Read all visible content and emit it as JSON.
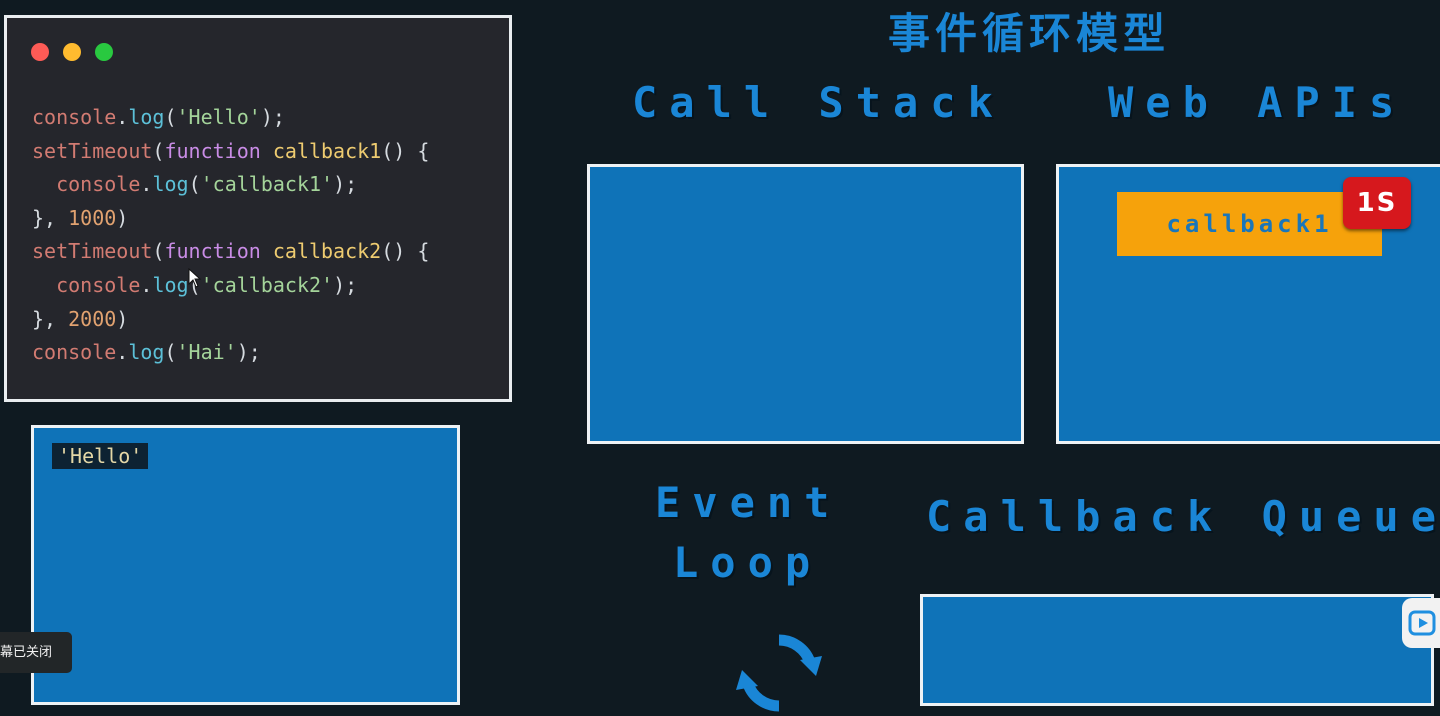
{
  "title": "事件循环模型",
  "code_window": {
    "lines": [
      [
        {
          "t": "console",
          "c": "obj"
        },
        {
          "t": ".",
          "c": "punc"
        },
        {
          "t": "log",
          "c": "fn"
        },
        {
          "t": "(",
          "c": "punc"
        },
        {
          "t": "'Hello'",
          "c": "str"
        },
        {
          "t": ");",
          "c": "punc"
        }
      ],
      [
        {
          "t": "setTimeout",
          "c": "obj"
        },
        {
          "t": "(",
          "c": "punc"
        },
        {
          "t": "function",
          "c": "kw"
        },
        {
          "t": " ",
          "c": "punc"
        },
        {
          "t": "callback1",
          "c": "name"
        },
        {
          "t": "() {",
          "c": "punc"
        }
      ],
      [
        {
          "t": "  ",
          "c": "punc"
        },
        {
          "t": "console",
          "c": "obj"
        },
        {
          "t": ".",
          "c": "punc"
        },
        {
          "t": "log",
          "c": "fn"
        },
        {
          "t": "(",
          "c": "punc"
        },
        {
          "t": "'callback1'",
          "c": "str"
        },
        {
          "t": ");",
          "c": "punc"
        }
      ],
      [
        {
          "t": "}, ",
          "c": "punc"
        },
        {
          "t": "1000",
          "c": "num"
        },
        {
          "t": ")",
          "c": "punc"
        }
      ],
      [
        {
          "t": "setTimeout",
          "c": "obj"
        },
        {
          "t": "(",
          "c": "punc"
        },
        {
          "t": "function",
          "c": "kw"
        },
        {
          "t": " ",
          "c": "punc"
        },
        {
          "t": "callback2",
          "c": "name"
        },
        {
          "t": "() {",
          "c": "punc"
        }
      ],
      [
        {
          "t": "  ",
          "c": "punc"
        },
        {
          "t": "console",
          "c": "obj"
        },
        {
          "t": ".",
          "c": "punc"
        },
        {
          "t": "log",
          "c": "fn"
        },
        {
          "t": "(",
          "c": "punc"
        },
        {
          "t": "'callback2'",
          "c": "str"
        },
        {
          "t": ");",
          "c": "punc"
        }
      ],
      [
        {
          "t": "}, ",
          "c": "punc"
        },
        {
          "t": "2000",
          "c": "num"
        },
        {
          "t": ")",
          "c": "punc"
        }
      ],
      [
        {
          "t": "console",
          "c": "obj"
        },
        {
          "t": ".",
          "c": "punc"
        },
        {
          "t": "log",
          "c": "fn"
        },
        {
          "t": "(",
          "c": "punc"
        },
        {
          "t": "'Hai'",
          "c": "str"
        },
        {
          "t": ");",
          "c": "punc"
        }
      ]
    ]
  },
  "console_output": {
    "items": [
      "'Hello'"
    ]
  },
  "labels": {
    "call_stack": "Call Stack",
    "web_apis": "Web APIs",
    "event_loop_line1": "Event",
    "event_loop_line2": "Loop",
    "callback_queue": "Callback Queue"
  },
  "web_apis": {
    "callback_name": "callback1",
    "timer_label": "1S"
  },
  "player": {
    "subtitle_status": "幕已关闭"
  },
  "colors": {
    "background": "#0f1a21",
    "panel_blue": "#0f73b8",
    "label_blue": "#1a86d6",
    "callback_orange": "#f6a20b",
    "timer_red": "#d6181d"
  }
}
